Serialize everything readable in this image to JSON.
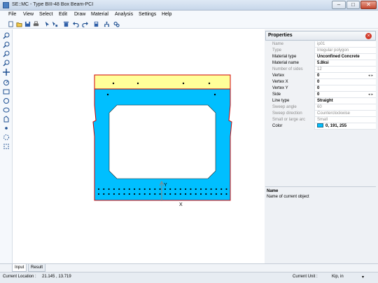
{
  "window": {
    "title": "SE::MC - Type BIII-48 Box Beam-PCI"
  },
  "menu": [
    "File",
    "View",
    "Select",
    "Edit",
    "Draw",
    "Material",
    "Analysis",
    "Settings",
    "Help"
  ],
  "toolbar_icons": [
    "new-icon",
    "open-icon",
    "save-icon",
    "print-icon",
    "pointer-icon",
    "node-pointer-icon",
    "delete-icon",
    "undo-icon",
    "redo-icon",
    "calculator-icon",
    "hierarchy-icon",
    "settings-icon"
  ],
  "toolbox_icons": [
    "zoom-in-icon",
    "zoom-out-icon",
    "zoom-window-icon",
    "zoom-fit-icon",
    "pan-icon",
    "rotate-icon",
    "rectangle-icon",
    "circle-icon",
    "ellipse-icon",
    "polygon-icon",
    "point-icon",
    "circle-dashed-icon",
    "grid-dots-icon"
  ],
  "canvas": {
    "axis_y_label": "Y",
    "axis_x_label": "X",
    "colors": {
      "beam_fill": "#00bfff",
      "top_flange_fill": "#ffff99",
      "outline": "#d00000"
    }
  },
  "properties": {
    "title": "Properties",
    "rows": [
      {
        "key": "Name",
        "value": "ip01",
        "readonly": true
      },
      {
        "key": "Type",
        "value": "Irregular polygon",
        "readonly": true
      },
      {
        "key": "Material type",
        "value": "Unconfined Concrete",
        "bold": true
      },
      {
        "key": "Material name",
        "value": "5.8ksi",
        "bold": true
      },
      {
        "key": "Number of sides",
        "value": "12",
        "readonly": true
      },
      {
        "key": "Vertex",
        "value": "0",
        "bold": true,
        "spin": true
      },
      {
        "key": "Vertex X",
        "value": "0",
        "bold": true
      },
      {
        "key": "Vertex Y",
        "value": "0",
        "bold": true
      },
      {
        "key": "Side",
        "value": "0",
        "bold": true,
        "spin": true
      },
      {
        "key": "Line type",
        "value": "Straight",
        "bold": true
      },
      {
        "key": "Sweep angle",
        "value": "60",
        "readonly": true
      },
      {
        "key": "Sweep direction",
        "value": "Counterclockwise",
        "readonly": true
      },
      {
        "key": "Small or large arc",
        "value": "Small",
        "readonly": true
      },
      {
        "key": "Color",
        "value": "0, 191, 255",
        "bold": true,
        "swatch": "#00bfff"
      }
    ],
    "description": {
      "name": "Name",
      "text": "Name of current object"
    }
  },
  "tabs": [
    {
      "label": "Input",
      "active": true
    },
    {
      "label": "Result",
      "active": false
    }
  ],
  "status": {
    "location_label": "Current Location :",
    "location_value": "21.145 , 13.719",
    "unit_label": "Current Unit :",
    "unit_value": "Kip, in"
  }
}
